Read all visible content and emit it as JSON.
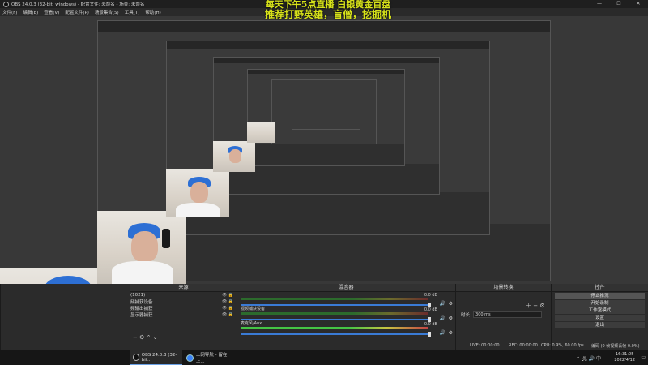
{
  "window": {
    "title": "OBS 24.0.3 (32-bit, windows) - 配置文件: 未命名 - 场景: 未命名",
    "controls": [
      "—",
      "☐",
      "✕"
    ]
  },
  "menu": [
    "文件(F)",
    "编辑(E)",
    "查看(V)",
    "配置文件(P)",
    "场景集合(S)",
    "工具(T)",
    "帮助(H)"
  ],
  "overlay": {
    "line1": "每天下午5点直播  白银黄金百盘",
    "line2": "推荐打野英雄，盲僧，挖掘机"
  },
  "docks": {
    "sources": {
      "title": "来源",
      "items": [
        "(1021)",
        "频捕获设备",
        "频输出捕获",
        "显示器捕获"
      ]
    },
    "mixer": {
      "title": "混音器",
      "tracks": [
        {
          "label": "",
          "db": "0.0 dB"
        },
        {
          "label": "视频捕获设备",
          "db": "0.0 dB"
        },
        {
          "label": "麦克风/Aux",
          "db": "0.0 dB"
        }
      ]
    },
    "transitions": {
      "title": "场景转换",
      "duration_label": "时长",
      "duration_value": "300 ms"
    },
    "controls": {
      "title": "控件",
      "buttons": [
        "停止推流",
        "开始录制",
        "工作室模式",
        "设置",
        "退出"
      ]
    }
  },
  "status": {
    "live": "LIVE: 00:00:00",
    "rec": "REC: 00:00:00",
    "cpu": "CPU: 0.9%, 60.00 fps",
    "dropped": "编码 (0 帧视频丢帧 0.0%)"
  },
  "taskbar": {
    "items": [
      {
        "label": "OBS 24.0.3 (32-bit..."
      },
      {
        "label": "上网导航 - 留在上..."
      }
    ],
    "time": "16:31:05",
    "date": "2022/4/12"
  },
  "colors": {
    "overlay_text": "#d7e21a",
    "hair": "#2d6fd4",
    "accent": "#3a7bd5"
  }
}
